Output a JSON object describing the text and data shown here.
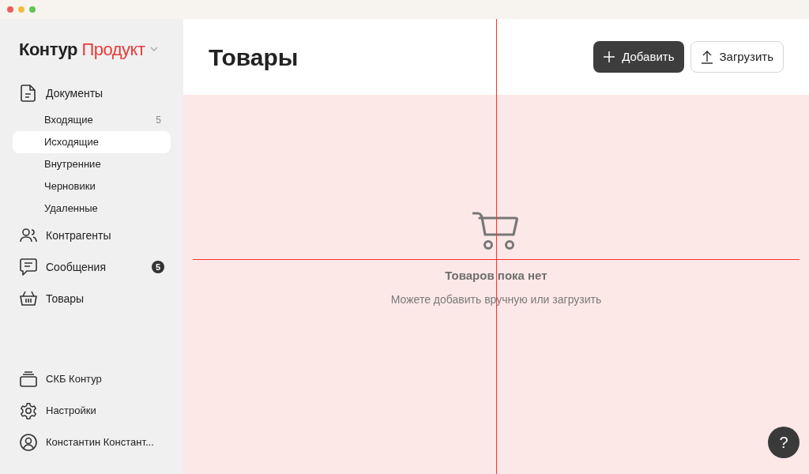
{
  "brand": {
    "name": "Контур",
    "product": "Продукт"
  },
  "sidebar": {
    "items": [
      {
        "label": "Документы",
        "children": [
          {
            "label": "Входящие",
            "count": "5",
            "selected": false
          },
          {
            "label": "Исходящие",
            "selected": true
          },
          {
            "label": "Внутренние",
            "selected": false
          },
          {
            "label": "Черновики",
            "selected": false
          },
          {
            "label": "Удаленные",
            "selected": false
          }
        ]
      },
      {
        "label": "Контрагенты"
      },
      {
        "label": "Сообщения",
        "badge": "5"
      },
      {
        "label": "Товары"
      }
    ],
    "footer": [
      {
        "label": "СКБ Контур"
      },
      {
        "label": "Настройки"
      },
      {
        "label": "Константин Констант..."
      }
    ]
  },
  "page": {
    "title": "Товары",
    "buttons": [
      {
        "label": "Добавить",
        "kind": "primary"
      },
      {
        "label": "Загрузить",
        "kind": "secondary"
      }
    ]
  },
  "empty_state": {
    "title": "Товаров пока нет",
    "hint": "Можете добавить вручную или загрузить"
  },
  "help_button": {
    "label": "?"
  }
}
